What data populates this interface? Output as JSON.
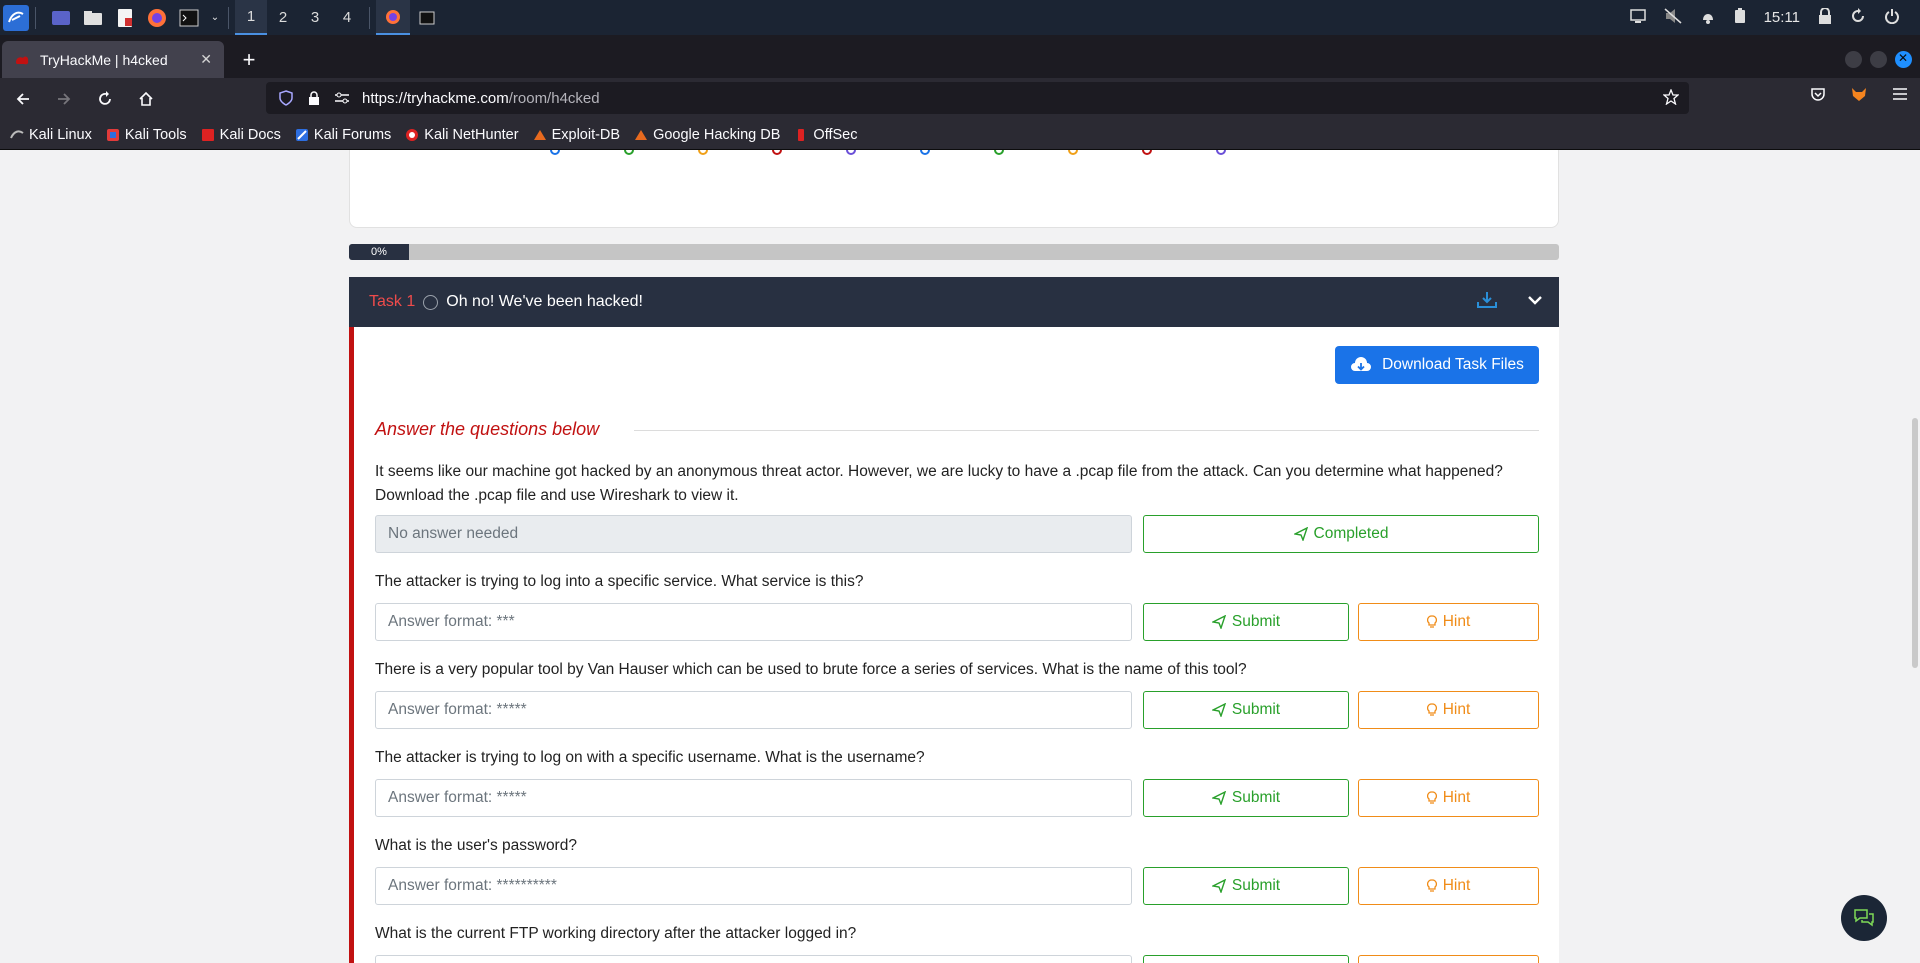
{
  "taskbar": {
    "workspaces": [
      "1",
      "2",
      "3",
      "4"
    ],
    "clock": "15:11"
  },
  "browser": {
    "tab_title": "TryHackMe | h4cked",
    "url_host": "https://tryhackme.com",
    "url_path": "/room/h4cked",
    "bookmarks": [
      "Kali Linux",
      "Kali Tools",
      "Kali Docs",
      "Kali Forums",
      "Kali NetHunter",
      "Exploit-DB",
      "Google Hacking DB",
      "OffSec"
    ]
  },
  "room": {
    "progress_label": "0%",
    "progress": 0
  },
  "task": {
    "number": "Task 1",
    "title": "Oh no! We've been hacked!",
    "download_label": "Download Task Files",
    "section_title": "Answer the questions below",
    "questions": [
      {
        "text": "It seems like our machine got hacked by an anonymous threat actor. However, we are lucky to have a .pcap file from the attack. Can you determine what happened? Download the .pcap file and use Wireshark to view it.",
        "placeholder": "No answer needed",
        "button": "Completed"
      },
      {
        "text": "The attacker is trying to log into a specific service. What service is this?",
        "placeholder": "Answer format: ***",
        "button": "Submit",
        "hint": "Hint"
      },
      {
        "text": "There is a very popular tool by Van Hauser which can be used to brute force a series of services. What is the name of this tool?",
        "placeholder": "Answer format: *****",
        "button": "Submit",
        "hint": "Hint"
      },
      {
        "text": "The attacker is trying to log on with a specific username. What is the username?",
        "placeholder": "Answer format: *****",
        "button": "Submit",
        "hint": "Hint"
      },
      {
        "text": "What is the user's password?",
        "placeholder": "Answer format: **********",
        "button": "Submit",
        "hint": "Hint"
      },
      {
        "text": "What is the current FTP working directory after the attacker logged in?"
      }
    ]
  },
  "colors": {
    "task_header": "#283041",
    "accent_red": "#c11111",
    "success": "#29a02b",
    "hint": "#f08c18",
    "primary": "#1a73e8"
  }
}
